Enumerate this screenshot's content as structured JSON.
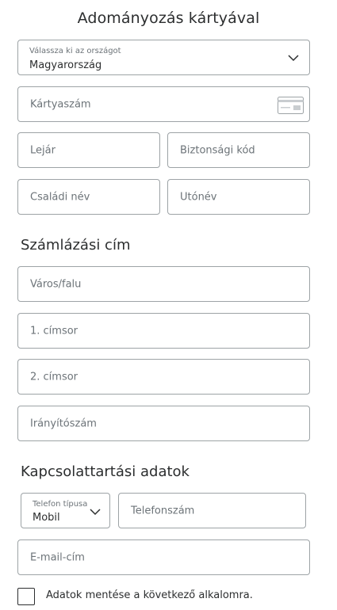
{
  "header": {
    "title": "Adományozás kártyával"
  },
  "country": {
    "label": "Válassza ki az országot",
    "value": "Magyarország"
  },
  "card": {
    "number_placeholder": "Kártyaszám",
    "expiry_placeholder": "Lejár",
    "security_placeholder": "Biztonsági kód",
    "last_name_placeholder": "Családi név",
    "first_name_placeholder": "Utónév"
  },
  "billing": {
    "heading": "Számlázási cím",
    "city_placeholder": "Város/falu",
    "address1_placeholder": "1. címsor",
    "address2_placeholder": "2. címsor",
    "zip_placeholder": "Irányítószám"
  },
  "contact": {
    "heading": "Kapcsolattartási adatok",
    "phone_type_label": "Telefon típusa",
    "phone_type_value": "Mobil",
    "phone_placeholder": "Telefonszám",
    "email_placeholder": "E-mail-cím"
  },
  "save": {
    "label": "Adatok mentése a következő alkalomra.",
    "checked": false
  }
}
